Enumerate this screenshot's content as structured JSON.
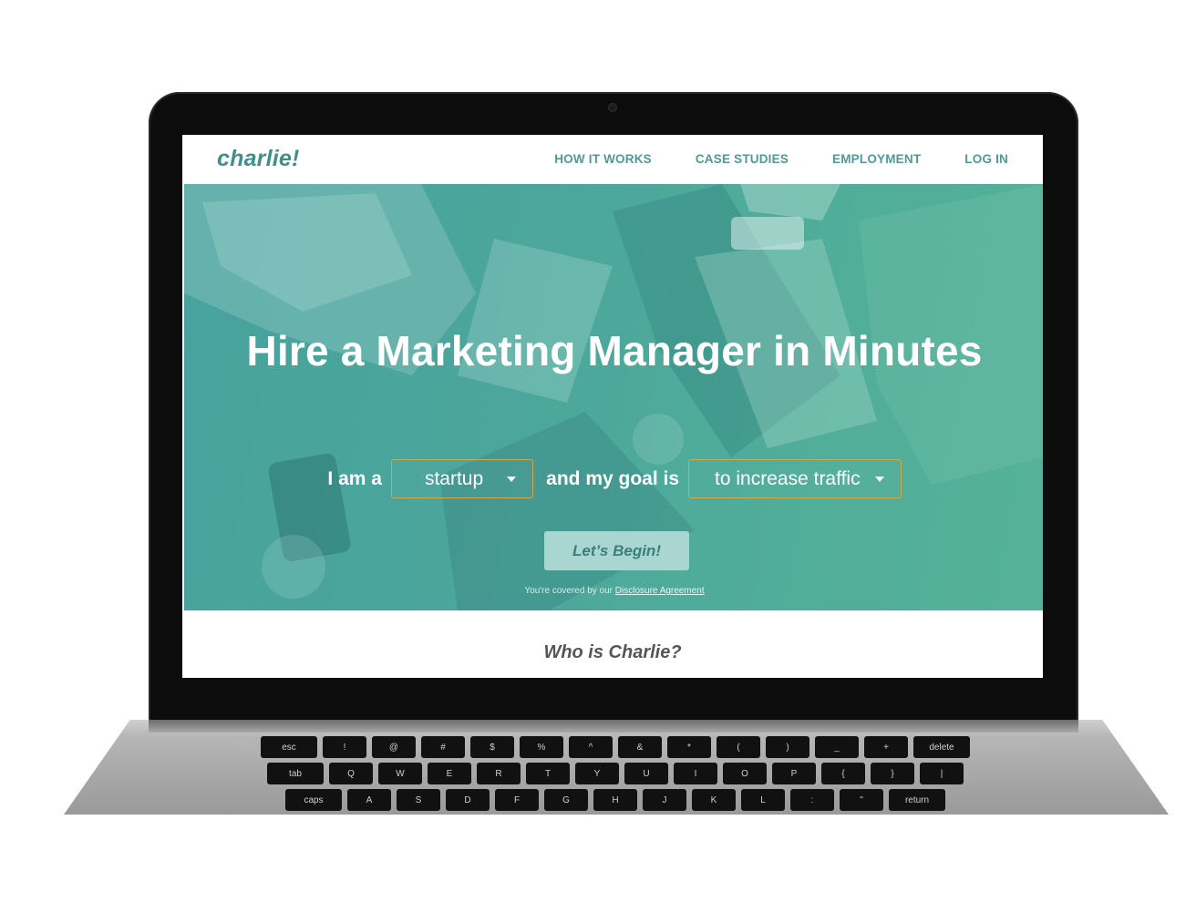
{
  "site": {
    "logo": "charlie!",
    "nav": {
      "how_it_works": "HOW IT WORKS",
      "case_studies": "CASE STUDIES",
      "employment": "EMPLOYMENT",
      "log_in": "LOG IN"
    }
  },
  "hero": {
    "title": "Hire a Marketing Manager in Minutes",
    "form": {
      "prefix": "I am a",
      "role_value": "startup",
      "middle": "and my goal is",
      "goal_value": "to increase traffic"
    },
    "cta": "Let’s Begin!",
    "disclosure_text": "You're covered by our ",
    "disclosure_link": "Disclosure Agreement"
  },
  "section": {
    "who_title": "Who is Charlie?"
  },
  "keyboard": {
    "row1": [
      "esc",
      "!",
      "@",
      "#",
      "$",
      "%",
      "^",
      "&",
      "*",
      "(",
      ")",
      "_",
      "+",
      "delete"
    ],
    "row2": [
      "tab",
      "Q",
      "W",
      "E",
      "R",
      "T",
      "Y",
      "U",
      "I",
      "O",
      "P",
      "{",
      "}",
      "|"
    ],
    "row3": [
      "caps",
      "A",
      "S",
      "D",
      "F",
      "G",
      "H",
      "J",
      "K",
      "L",
      ":",
      "\"",
      "return"
    ]
  },
  "colors": {
    "brand": "#3f8f8c",
    "select_border": "#d4a94a",
    "cta_bg": "#a9d6d0"
  }
}
